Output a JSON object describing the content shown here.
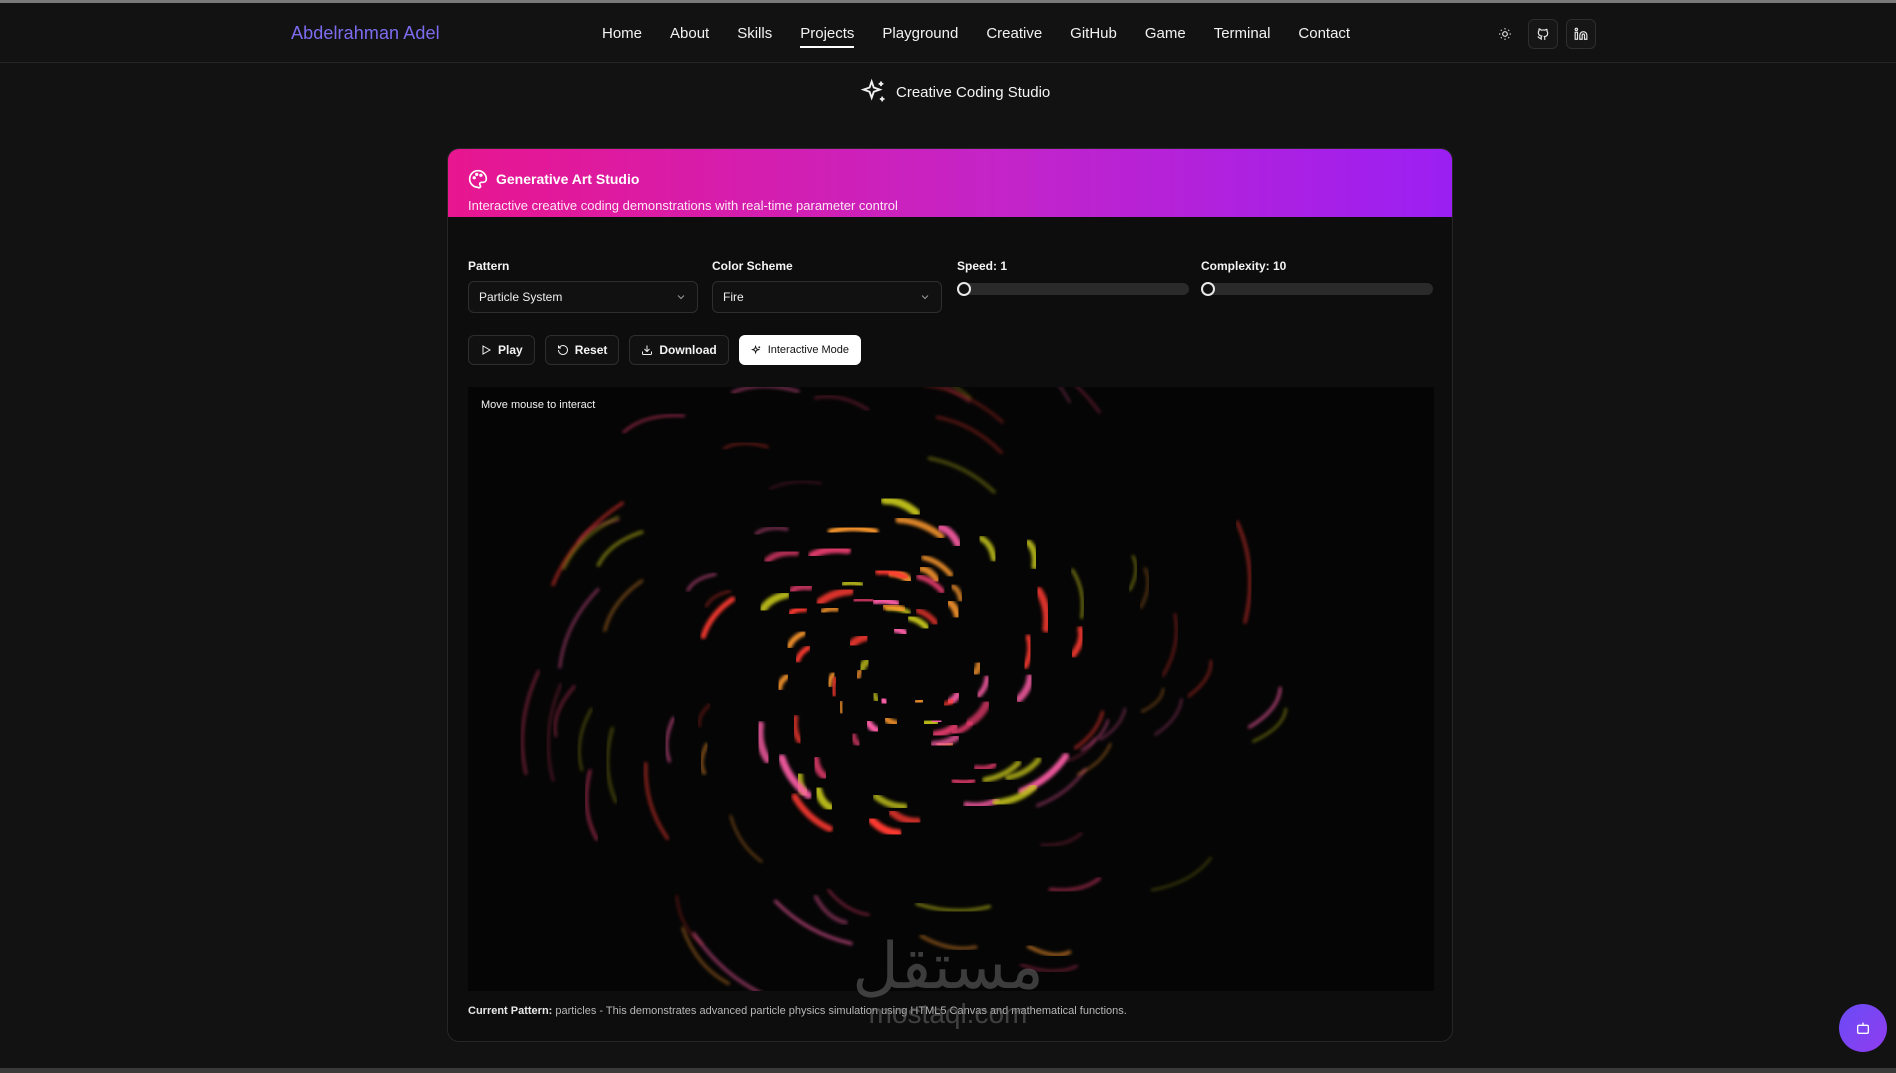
{
  "brand": "Abdelrahman Adel",
  "nav": {
    "items": [
      {
        "label": "Home",
        "active": false
      },
      {
        "label": "About",
        "active": false
      },
      {
        "label": "Skills",
        "active": false
      },
      {
        "label": "Projects",
        "active": true
      },
      {
        "label": "Playground",
        "active": false
      },
      {
        "label": "Creative",
        "active": false
      },
      {
        "label": "GitHub",
        "active": false
      },
      {
        "label": "Game",
        "active": false
      },
      {
        "label": "Terminal",
        "active": false
      },
      {
        "label": "Contact",
        "active": false
      }
    ],
    "icons": [
      "sun-icon",
      "github-icon",
      "linkedin-icon"
    ]
  },
  "page_title": "Creative Coding Studio",
  "card": {
    "title": "Generative Art Studio",
    "subtitle": "Interactive creative coding demonstrations with real-time parameter control",
    "gradient": [
      "#e8168f",
      "#9b1ff3"
    ]
  },
  "controls": {
    "pattern": {
      "label": "Pattern",
      "value": "Particle System"
    },
    "color_scheme": {
      "label": "Color Scheme",
      "value": "Fire"
    },
    "speed": {
      "label": "Speed: 1",
      "value": 1,
      "min": 1,
      "max": 10
    },
    "complexity": {
      "label": "Complexity: 10",
      "value": 10,
      "min": 10,
      "max": 100
    }
  },
  "buttons": {
    "play": "Play",
    "reset": "Reset",
    "download": "Download",
    "interactive": "Interactive Mode"
  },
  "canvas": {
    "hint": "Move mouse to interact",
    "palette": [
      "#ff3b30",
      "#ff5fa8",
      "#ff9a2e",
      "#c8c81e",
      "#e03a6a"
    ]
  },
  "footer": {
    "label": "Current Pattern:",
    "text": " particles - This demonstrates advanced particle physics simulation using HTML5 Canvas and mathematical functions."
  },
  "watermark": {
    "arabic": "مستقل",
    "latin": "mostaql.com"
  },
  "colors": {
    "background": "#121212",
    "brand": "#7c6cf0",
    "fab": "#6a4cf5"
  }
}
